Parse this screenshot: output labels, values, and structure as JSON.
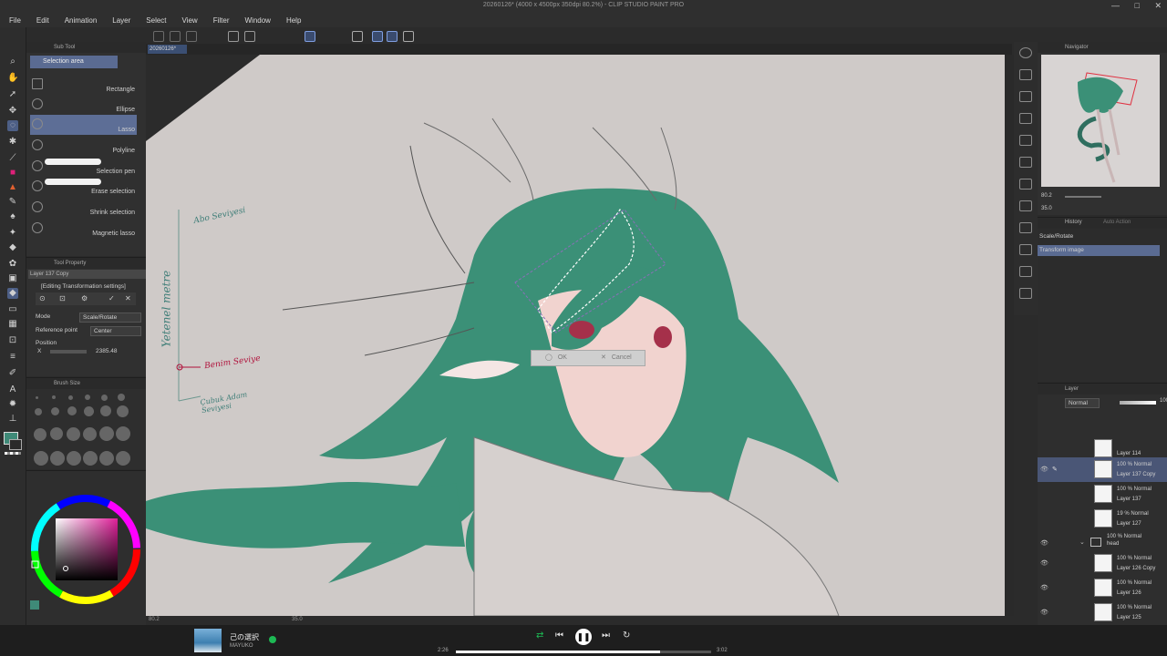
{
  "window": {
    "title": "20260126* (4000 x 4500px 350dpi 80.2%) - CLIP STUDIO PAINT PRO",
    "controls": [
      "—",
      "□",
      "✕"
    ]
  },
  "menu": [
    "File",
    "Edit",
    "Animation",
    "Layer",
    "Select",
    "View",
    "Filter",
    "Window",
    "Help"
  ],
  "canvas_tab": "20260126*",
  "subtool": {
    "panel_title": "Sub Tool",
    "group_tab": "Selection area",
    "items": [
      {
        "label": "Rectangle",
        "icon": "rectangle-select-icon"
      },
      {
        "label": "Ellipse",
        "icon": "ellipse-select-icon"
      },
      {
        "label": "Lasso",
        "icon": "lasso-icon",
        "active": true
      },
      {
        "label": "Polyline",
        "icon": "polyline-icon"
      },
      {
        "label": "Selection pen",
        "icon": "selection-pen-icon"
      },
      {
        "label": "Erase selection",
        "icon": "erase-selection-icon"
      },
      {
        "label": "Shrink selection",
        "icon": "shrink-selection-icon"
      },
      {
        "label": "Magnetic lasso",
        "icon": "magnetic-lasso-icon"
      }
    ]
  },
  "tool_property": {
    "panel_title": "Tool Property",
    "layer_name": "Layer 137 Copy",
    "editing_label": "[Editing Transformation settings]",
    "mode_label": "Mode",
    "mode_value": "Scale/Rotate",
    "ref_label": "Reference point",
    "ref_value": "Center",
    "position_label": "Position",
    "x_label": "X",
    "x_value": "2385.48"
  },
  "brush_size": {
    "panel_title": "Brush Size"
  },
  "color": {
    "current": "#3f8a78",
    "wheel_picker": "#cc3377"
  },
  "canvas": {
    "status_zoom": "80.2",
    "status_angle": "35.0",
    "annotations": {
      "top": "Abo Seviyesi",
      "side": "Yetenel metre",
      "mid": "Benim Seviye",
      "bottom": "Çubuk Adam Seviyesi"
    }
  },
  "transform_bar": {
    "ok": "OK",
    "cancel": "Cancel"
  },
  "navigator": {
    "panel_title": "Navigator",
    "zoom": "80.2",
    "angle": "35.0"
  },
  "history": {
    "tabs": [
      "History",
      "Auto Action"
    ],
    "items": [
      {
        "label": "Scale/Rotate",
        "active": false
      },
      {
        "label": "Transform image",
        "active": true
      }
    ]
  },
  "layers": {
    "panel_title": "Layer",
    "blend_mode": "Normal",
    "opacity": "100",
    "items": [
      {
        "mode": "",
        "name": "Layer 114",
        "active": false
      },
      {
        "mode": "100 % Normal",
        "name": "Layer 137 Copy",
        "active": true
      },
      {
        "mode": "100 % Normal",
        "name": "Layer 137",
        "active": false
      },
      {
        "mode": "19 % Normal",
        "name": "Layer 127",
        "active": false
      },
      {
        "mode": "100 % Normal",
        "name": "head",
        "active": false,
        "folder": true
      },
      {
        "mode": "100 % Normal",
        "name": "Layer 126 Copy",
        "active": false
      },
      {
        "mode": "100 % Normal",
        "name": "Layer 126",
        "active": false
      },
      {
        "mode": "100 % Normal",
        "name": "Layer 125",
        "active": false
      }
    ]
  },
  "player": {
    "track_title": "己の選択",
    "artist": "MAYUKO",
    "elapsed": "2:26",
    "duration": "3:02",
    "progress": 0.8
  }
}
